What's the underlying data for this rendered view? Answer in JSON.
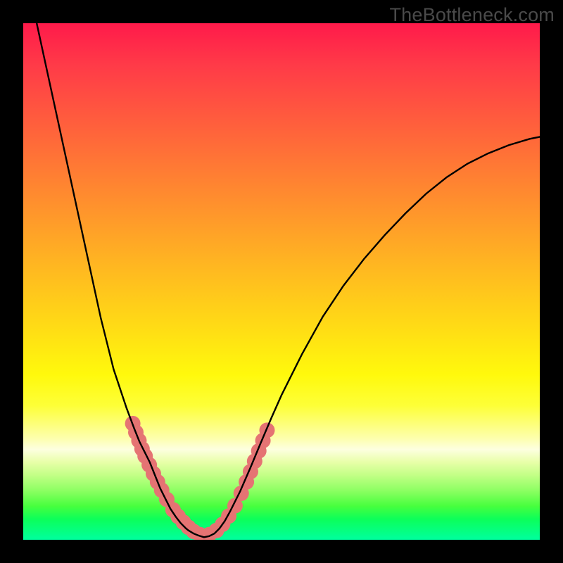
{
  "watermark": "TheBottleneck.com",
  "colors": {
    "frame": "#000000",
    "curve": "#000000",
    "marker_fill": "#e57373",
    "marker_stroke": "#cc6060",
    "gradient_stops": [
      "#ff1a4a",
      "#ff3a48",
      "#ff5a3e",
      "#ff7a34",
      "#ff9a2a",
      "#ffba20",
      "#ffd916",
      "#fff90c",
      "#fdff37",
      "#fdffb0",
      "#fdffe0",
      "#e8ffa8",
      "#c2ff86",
      "#8cff62",
      "#47ff3e",
      "#0cff5a",
      "#00ff9e"
    ]
  },
  "chart_data": {
    "type": "line",
    "title": "",
    "xlabel": "",
    "ylabel": "",
    "x": [
      0.0,
      0.025,
      0.05,
      0.075,
      0.1,
      0.125,
      0.15,
      0.175,
      0.2,
      0.215,
      0.225,
      0.235,
      0.245,
      0.255,
      0.265,
      0.275,
      0.285,
      0.295,
      0.305,
      0.315,
      0.32,
      0.33,
      0.34,
      0.35,
      0.36,
      0.37,
      0.38,
      0.39,
      0.4,
      0.42,
      0.44,
      0.46,
      0.48,
      0.5,
      0.54,
      0.58,
      0.62,
      0.66,
      0.7,
      0.74,
      0.78,
      0.82,
      0.86,
      0.9,
      0.94,
      0.98,
      1.0
    ],
    "y": [
      1.12,
      1.005,
      0.89,
      0.775,
      0.66,
      0.545,
      0.43,
      0.33,
      0.255,
      0.215,
      0.19,
      0.17,
      0.15,
      0.125,
      0.1,
      0.08,
      0.06,
      0.045,
      0.032,
      0.022,
      0.018,
      0.012,
      0.008,
      0.005,
      0.007,
      0.012,
      0.022,
      0.036,
      0.054,
      0.094,
      0.14,
      0.188,
      0.235,
      0.28,
      0.36,
      0.432,
      0.492,
      0.544,
      0.59,
      0.632,
      0.67,
      0.702,
      0.728,
      0.748,
      0.764,
      0.776,
      0.78
    ],
    "xlim": [
      0,
      1
    ],
    "ylim": [
      0,
      1
    ],
    "markers_x": [
      0.212,
      0.218,
      0.224,
      0.23,
      0.236,
      0.244,
      0.252,
      0.26,
      0.268,
      0.278,
      0.29,
      0.3,
      0.31,
      0.32,
      0.33,
      0.342,
      0.36,
      0.374,
      0.386,
      0.398,
      0.41,
      0.422,
      0.432,
      0.44,
      0.448,
      0.456,
      0.464,
      0.472
    ],
    "markers_y": [
      0.225,
      0.208,
      0.192,
      0.176,
      0.162,
      0.145,
      0.128,
      0.112,
      0.096,
      0.078,
      0.058,
      0.045,
      0.034,
      0.024,
      0.016,
      0.01,
      0.01,
      0.018,
      0.03,
      0.046,
      0.066,
      0.09,
      0.112,
      0.132,
      0.152,
      0.172,
      0.192,
      0.212
    ],
    "marker_radius": 11
  }
}
